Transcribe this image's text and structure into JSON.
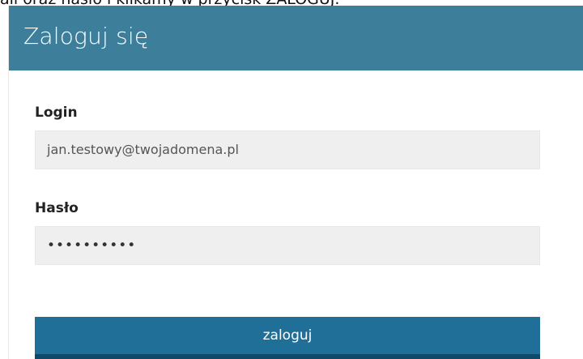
{
  "page": {
    "caption": "ail oraz hasło i klikamy w przycisk ZALOGUJ."
  },
  "login_panel": {
    "title": "Zaloguj się",
    "login_label": "Login",
    "login_value": "jan.testowy@twojadomena.pl",
    "password_label": "Hasło",
    "password_value": "••••••••••",
    "submit_label": "zaloguj"
  },
  "colors": {
    "header": "#3d7f9a",
    "button": "#1f6f98",
    "button_border": "#114866",
    "field_background": "#efefef"
  }
}
